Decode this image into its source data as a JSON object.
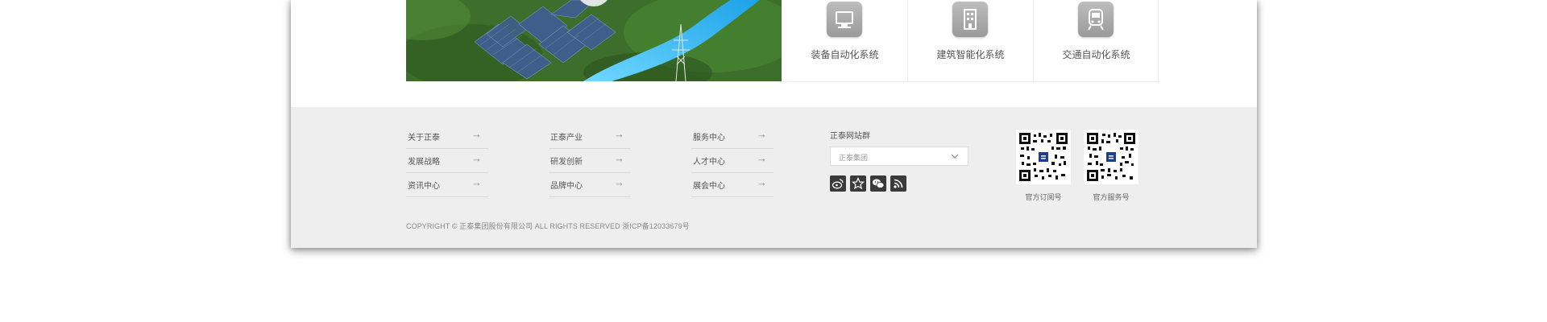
{
  "systems": [
    {
      "label": "装备自动化系统",
      "icon": "monitor-icon"
    },
    {
      "label": "建筑智能化系统",
      "icon": "building-icon"
    },
    {
      "label": "交通自动化系统",
      "icon": "train-icon"
    }
  ],
  "nav": [
    [
      {
        "label": "关于正泰",
        "arrow": "→"
      },
      {
        "label": "发展战略",
        "arrow": "→"
      },
      {
        "label": "资讯中心",
        "arrow": "→"
      }
    ],
    [
      {
        "label": "正泰产业",
        "arrow": "→"
      },
      {
        "label": "研发创新",
        "arrow": "→"
      },
      {
        "label": "品牌中心",
        "arrow": "→"
      }
    ],
    [
      {
        "label": "服务中心",
        "arrow": "→"
      },
      {
        "label": "人才中心",
        "arrow": "→"
      },
      {
        "label": "展会中心",
        "arrow": "→"
      }
    ]
  ],
  "sites": {
    "title": "正泰网站群",
    "selected": "正泰集团"
  },
  "social": [
    "weibo-icon",
    "star-icon",
    "wechat-icon",
    "rss-icon"
  ],
  "qrcodes": [
    {
      "caption": "官方订阅号"
    },
    {
      "caption": "官方服务号"
    }
  ],
  "copyright": "COPYRIGHT © 正泰集团股份有限公司 ALL RIGHTS RESERVED 浙ICP备12033679号",
  "colors": {
    "footer_bg": "#eeeeee",
    "icon_tile": "#a8a8a8",
    "social_bg": "#3a3a3a",
    "river": "#3db8f0"
  }
}
